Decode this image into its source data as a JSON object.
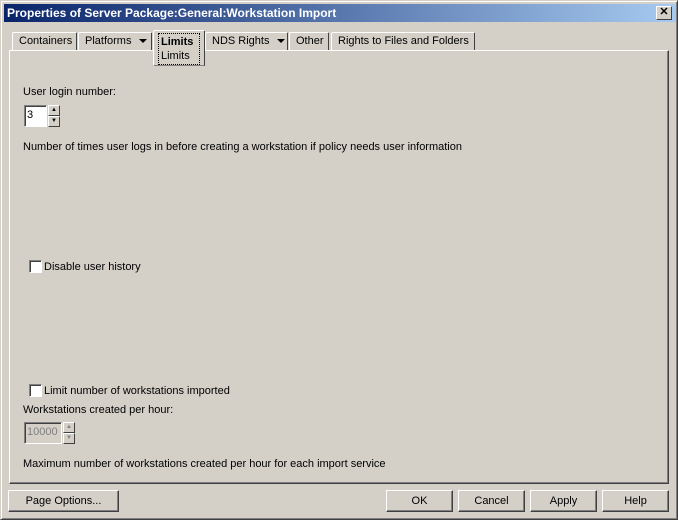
{
  "window": {
    "title": "Properties of Server Package:General:Workstation Import",
    "close_label": "✕"
  },
  "tabs": [
    {
      "label": "Containers"
    },
    {
      "label": "Platforms",
      "has_dropdown": true
    },
    {
      "label": "Limits",
      "sublabel": "Limits",
      "active": true
    },
    {
      "label": "NDS Rights",
      "has_dropdown": true
    },
    {
      "label": "Other"
    },
    {
      "label": "Rights to Files and Folders"
    }
  ],
  "limits": {
    "user_login_label": "User login number:",
    "user_login_value": "3",
    "user_login_desc": "Number of times user logs in before creating a workstation if policy needs user information",
    "disable_history_label": "Disable user history",
    "disable_history_checked": false,
    "limit_ws_label": "Limit number of workstations imported",
    "limit_ws_checked": false,
    "ws_per_hour_label": "Workstations created per hour:",
    "ws_per_hour_value": "10000",
    "ws_per_hour_desc": "Maximum number of workstations created per hour for each import service"
  },
  "buttons": {
    "page_options": "Page Options...",
    "ok": "OK",
    "cancel": "Cancel",
    "apply": "Apply",
    "help": "Help"
  }
}
